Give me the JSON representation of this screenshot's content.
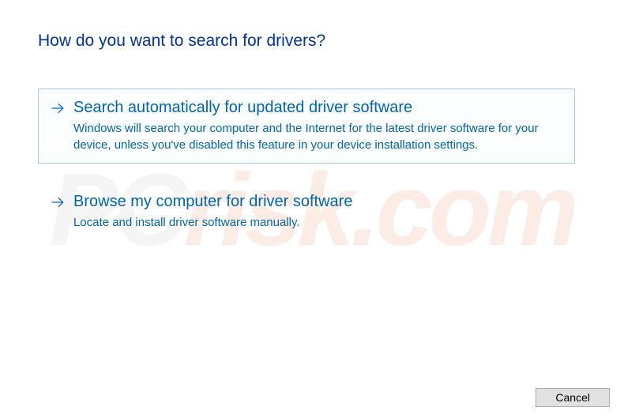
{
  "heading": "How do you want to search for drivers?",
  "options": [
    {
      "title": "Search automatically for updated driver software",
      "description": "Windows will search your computer and the Internet for the latest driver software for your device, unless you've disabled this feature in your device installation settings.",
      "selected": true
    },
    {
      "title": "Browse my computer for driver software",
      "description": "Locate and install driver software manually.",
      "selected": false
    }
  ],
  "buttons": {
    "cancel": "Cancel"
  },
  "watermark": {
    "pc": "PC",
    "risk": "risk.com"
  }
}
